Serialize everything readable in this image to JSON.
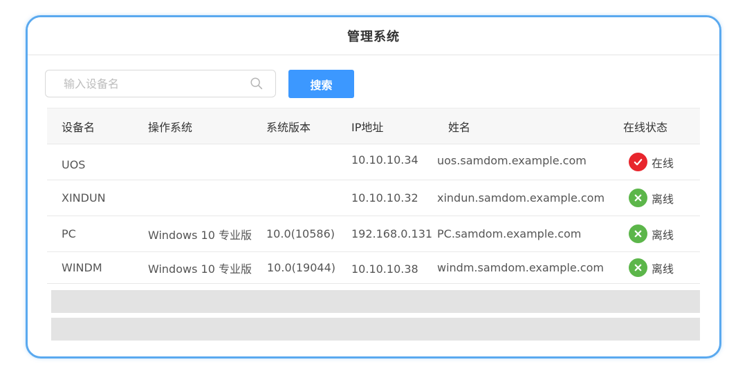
{
  "window": {
    "title": "管理系统"
  },
  "search": {
    "placeholder": "输入设备名",
    "button_label": "搜索"
  },
  "table": {
    "headers": [
      "设备名",
      "操作系统",
      "系统版本",
      "IP地址",
      "姓名",
      "在线状态"
    ],
    "rows": [
      {
        "device": "UOS",
        "os": "",
        "version": "",
        "ip": "10.10.10.34",
        "name": "uos.samdom.example.com",
        "status": "在线",
        "online": true
      },
      {
        "device": "XINDUN",
        "os": "",
        "version": "",
        "ip": "10.10.10.32",
        "name": "xindun.samdom.example.com",
        "status": "离线",
        "online": false
      },
      {
        "device": "PC",
        "os": "Windows 10 专业版",
        "version": "10.0(10586)",
        "ip": "192.168.0.131",
        "name": "PC.samdom.example.com",
        "status": "离线",
        "online": false
      },
      {
        "device": "WINDM",
        "os": "Windows 10 专业版",
        "version": "10.0(19044)",
        "ip": "10.10.10.38",
        "name": "windm.samdom.example.com",
        "status": "离线",
        "online": false
      }
    ]
  },
  "icons": {
    "search": "search-icon",
    "online": "check-circle-icon",
    "offline": "x-circle-icon"
  },
  "colors": {
    "accent": "#3c98ff",
    "frame": "#5aa9ef",
    "online": "#e8262d",
    "offline": "#5cb64a"
  }
}
